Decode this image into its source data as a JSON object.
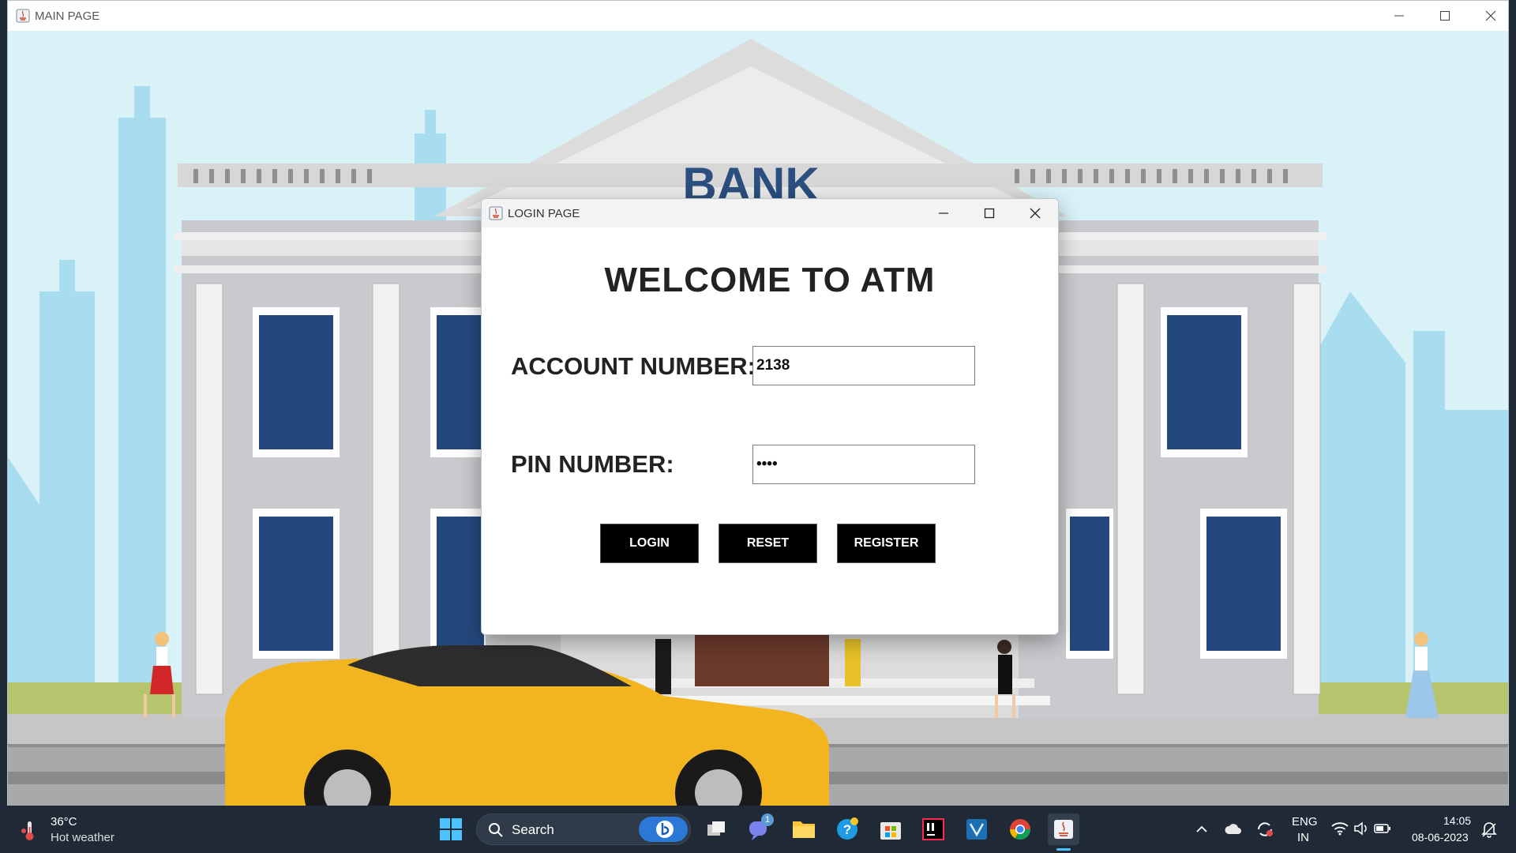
{
  "main_window": {
    "title": "MAIN PAGE",
    "scene": {
      "bank_sign": "BANK"
    }
  },
  "login_dialog": {
    "title": "LOGIN PAGE",
    "heading": "WELCOME TO ATM",
    "account_label": "ACCOUNT NUMBER:",
    "account_value": "2138",
    "pin_label": "PIN NUMBER:",
    "pin_value": "••••",
    "buttons": {
      "login": "LOGIN",
      "reset": "RESET",
      "register": "REGISTER"
    }
  },
  "taskbar": {
    "weather": {
      "temperature": "36°C",
      "description": "Hot weather"
    },
    "search_label": "Search",
    "chat_badge": "1",
    "language": {
      "line1": "ENG",
      "line2": "IN"
    },
    "clock": {
      "time": "14:05",
      "date": "08-06-2023"
    }
  },
  "colors": {
    "sky": "#d8f2f8",
    "taskbar": "#202a36",
    "button_black": "#000000",
    "taxi_yellow": "#f2b51f",
    "bank_sign_blue": "#2b4f7e"
  }
}
